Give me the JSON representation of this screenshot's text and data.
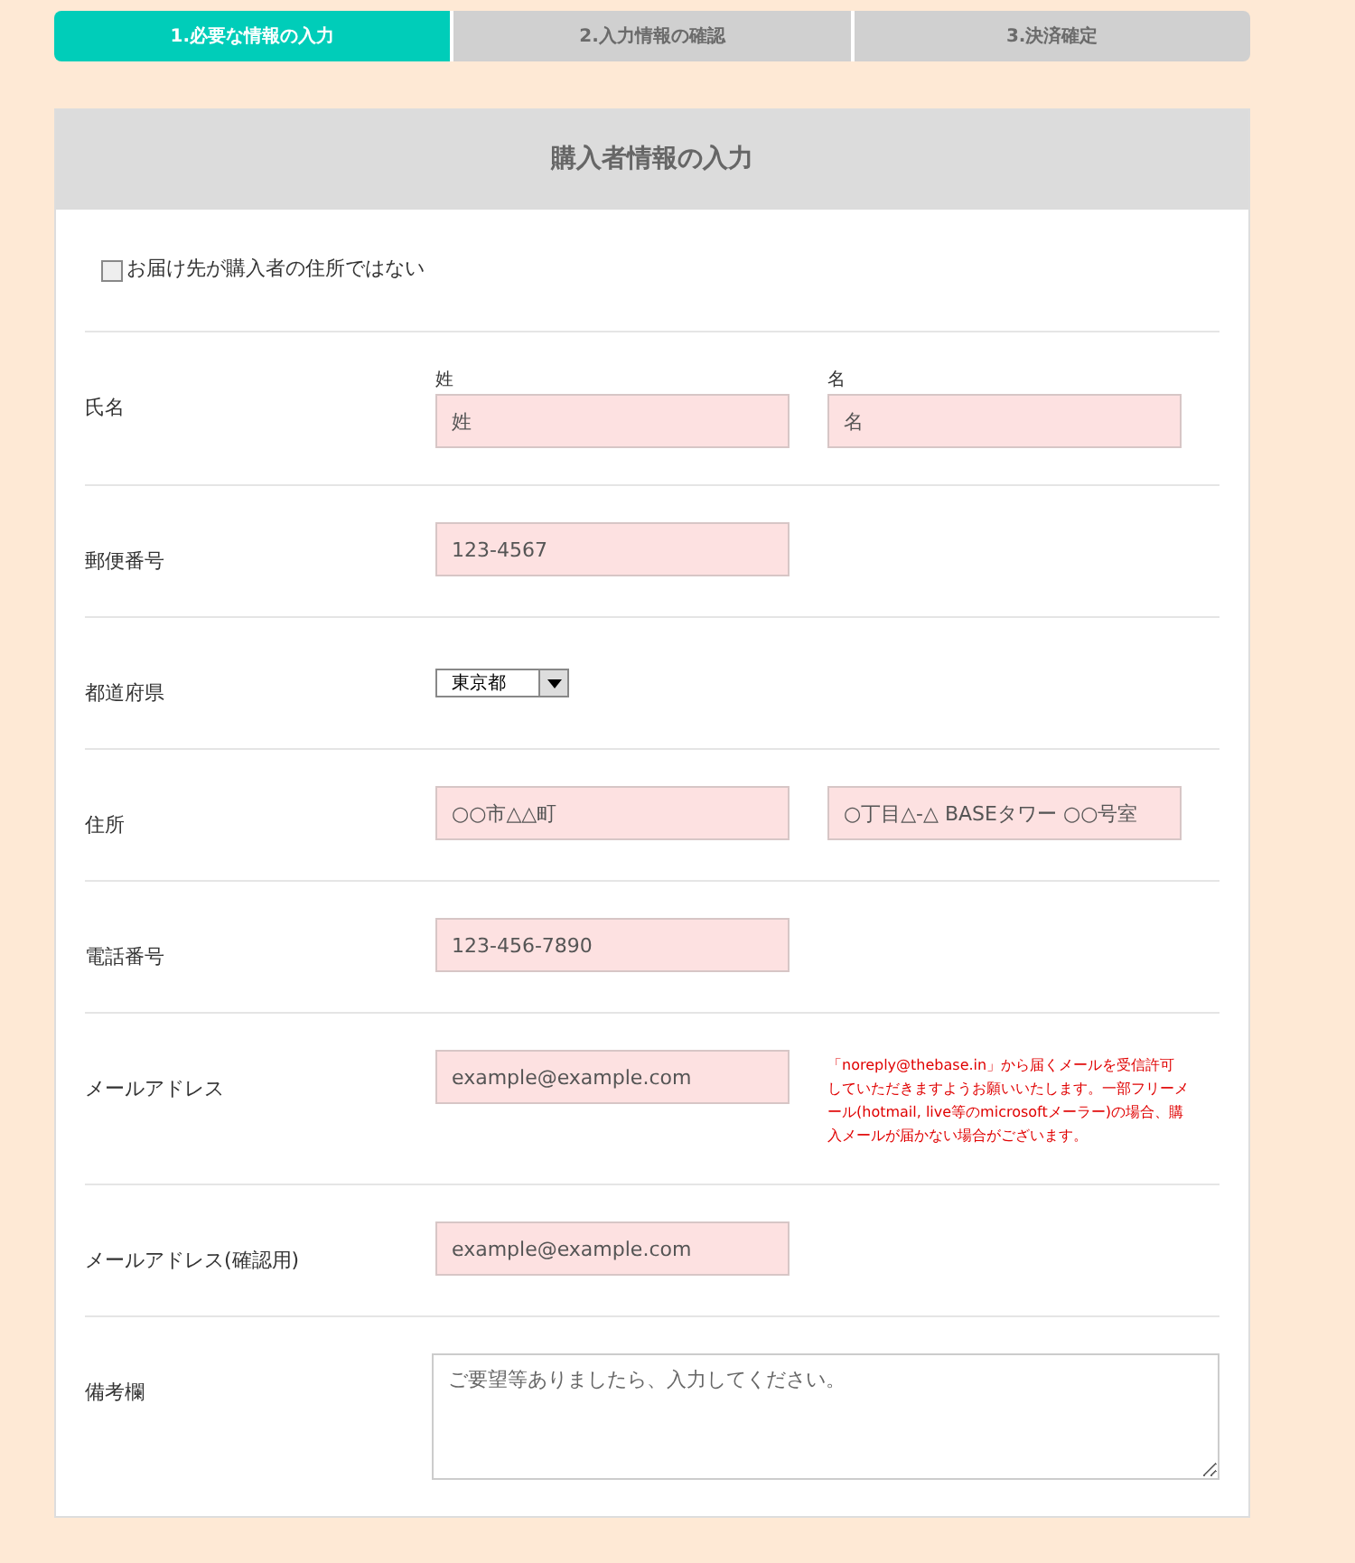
{
  "steps": [
    {
      "label": "1.必要な情報の入力",
      "selected": true
    },
    {
      "label": "2.入力情報の確認",
      "selected": false
    },
    {
      "label": "3.決済確定",
      "selected": false
    }
  ],
  "card": {
    "title": "購入者情報の入力",
    "checkbox": {
      "label": "お届け先が購入者の住所ではない",
      "checked": false
    },
    "rows": [
      {
        "label": "氏名",
        "kind": "text",
        "fields": [
          {
            "caption": "姓",
            "placeholder": "姓"
          },
          {
            "caption": "名",
            "placeholder": "名"
          }
        ]
      },
      {
        "label": "郵便番号",
        "kind": "text",
        "fields": [
          {
            "placeholder": "123-4567"
          }
        ]
      },
      {
        "label": "都道府県",
        "kind": "select",
        "value": "東京都"
      },
      {
        "label": "住所",
        "kind": "text",
        "fields": [
          {
            "placeholder": "○○市△△町"
          },
          {
            "placeholder": "○丁目△-△ BASEタワー ○○号室"
          }
        ]
      },
      {
        "label": "電話番号",
        "kind": "text",
        "fields": [
          {
            "placeholder": "123-456-7890"
          }
        ]
      },
      {
        "label": "メールアドレス",
        "kind": "text",
        "fields": [
          {
            "placeholder": "example@example.com"
          }
        ],
        "note": "「noreply@thebase.in」から届くメールを受信許可していただきますようお願いいたします。一部フリーメール(hotmail, live等のmicrosoftメーラー)の場合、購入メールが届かない場合がございます。"
      },
      {
        "label": "メールアドレス(確認用)",
        "kind": "text",
        "fields": [
          {
            "placeholder": "example@example.com"
          }
        ]
      },
      {
        "label": "備考欄",
        "kind": "textarea",
        "placeholder": "ご要望等ありましたら、入力してください。"
      }
    ]
  }
}
